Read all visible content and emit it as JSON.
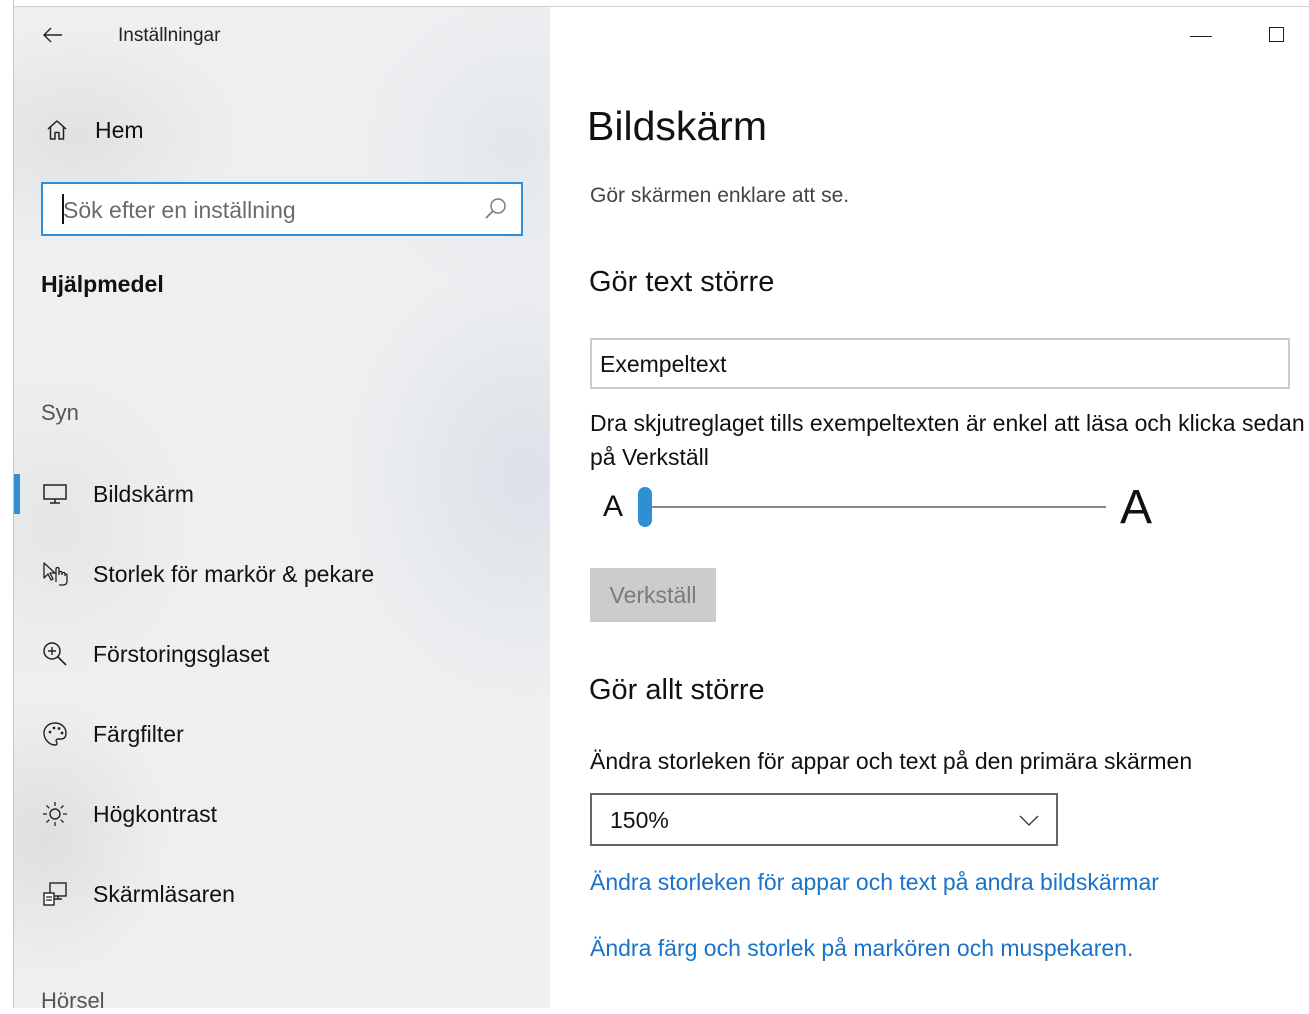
{
  "window": {
    "title": "Inställningar",
    "back_icon": "back-arrow-icon"
  },
  "sidebar": {
    "home_label": "Hem",
    "search_placeholder": "Sök efter en inställning",
    "section": "Hjälpmedel",
    "groups": [
      "Syn",
      "Hörsel"
    ],
    "items": [
      {
        "label": "Bildskärm",
        "icon": "monitor-icon",
        "selected": true
      },
      {
        "label": "Storlek för markör & pekare",
        "icon": "pointer-icon",
        "selected": false
      },
      {
        "label": "Förstoringsglaset",
        "icon": "magnifier-icon",
        "selected": false
      },
      {
        "label": "Färgfilter",
        "icon": "palette-icon",
        "selected": false
      },
      {
        "label": "Högkontrast",
        "icon": "sun-icon",
        "selected": false
      },
      {
        "label": "Skärmläsaren",
        "icon": "narrator-icon",
        "selected": false
      }
    ]
  },
  "main": {
    "title": "Bildskärm",
    "subtitle": "Gör skärmen enklare att se.",
    "text_section": {
      "heading": "Gör text större",
      "sample_text": "Exempeltext",
      "instruction": "Dra skjutreglaget tills exempeltexten är enkel att läsa och klicka sedan på Verkställ",
      "slider_min_label": "A",
      "slider_max_label": "A",
      "slider_level": 0,
      "apply_label": "Verkställ"
    },
    "everything_section": {
      "heading": "Gör allt större",
      "description": "Ändra storleken för appar och text på den primära skärmen",
      "scale_value": "150%",
      "link_other_displays": "Ändra storleken för appar och text på andra bildskärmar",
      "link_cursor": "Ändra färg och storlek på markören och muspekaren."
    }
  },
  "colors": {
    "accent": "#2f8fd5",
    "link": "#1a73c9",
    "sidebar_bg": "#eeeff1"
  }
}
